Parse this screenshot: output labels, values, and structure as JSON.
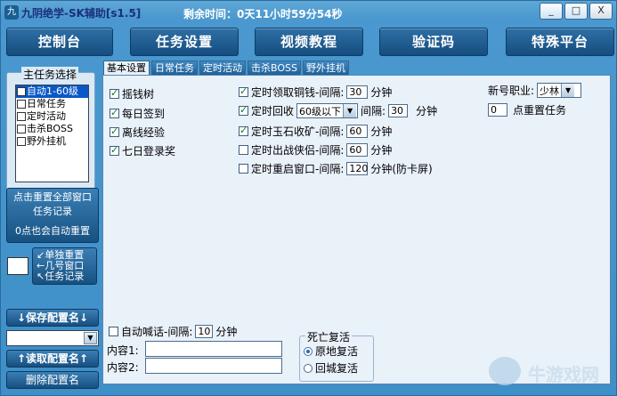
{
  "window": {
    "title": "九阴绝学-SK辅助[s1.5]",
    "timer": "剩余时间：0天11小时59分54秒",
    "buttons": [
      "_",
      "□",
      "X"
    ]
  },
  "topnav": [
    "控制台",
    "任务设置",
    "视频教程",
    "验证码",
    "特殊平台"
  ],
  "left": {
    "group_label": "主任务选择",
    "tasks": [
      "自动1-60级",
      "日常任务",
      "定时活动",
      "击杀BOSS",
      "野外挂机"
    ],
    "reset_button": {
      "line1": "点击重置全部窗口",
      "line2": "任务记录",
      "line3": "0点也会自动重置"
    },
    "single_reset": [
      "↙单独重置",
      "←几号窗口",
      "↖任务记录"
    ],
    "save_label": "↓保存配置名↓",
    "load_label": "↑读取配置名↑",
    "delete_label": "删除配置名"
  },
  "tabs": [
    "基本设置",
    "日常任务",
    "定时活动",
    "击杀BOSS",
    "野外挂机"
  ],
  "basic": {
    "left_checks": [
      {
        "label": "摇钱树",
        "checked": true
      },
      {
        "label": "每日签到",
        "checked": true
      },
      {
        "label": "离线经验",
        "checked": true
      },
      {
        "label": "七日登录奖",
        "checked": true
      }
    ],
    "timed": {
      "money": {
        "label": "定时领取铜钱-间隔:",
        "value": "30",
        "unit": "分钟",
        "checked": true
      },
      "recycle": {
        "label": "定时回收",
        "level": "60级以下",
        "interval_label": "间隔:",
        "value": "30",
        "unit": "分钟",
        "checked": true
      },
      "mining": {
        "label": "定时玉石收矿-间隔:",
        "value": "60",
        "unit": "分钟",
        "checked": true
      },
      "hero": {
        "label": "定时出战侠侣-间隔:",
        "value": "60",
        "unit": "分钟",
        "checked": false
      },
      "restart": {
        "label": "定时重启窗口-间隔:",
        "value": "120",
        "unit": "分钟(防卡屏)",
        "checked": false
      }
    },
    "new_class": {
      "label": "新号职业:",
      "value": "少林"
    },
    "reset_task": {
      "value": "0",
      "label": "点重置任务"
    },
    "auto_shout": {
      "label": "自动喊话-间隔:",
      "value": "10",
      "unit": "分钟",
      "checked": false
    },
    "content1_label": "内容1:",
    "content2_label": "内容2:",
    "death": {
      "label": "死亡复活",
      "options": [
        {
          "label": "原地复活",
          "selected": true
        },
        {
          "label": "回城复活",
          "selected": false
        }
      ]
    }
  },
  "watermark": "牛游戏网"
}
